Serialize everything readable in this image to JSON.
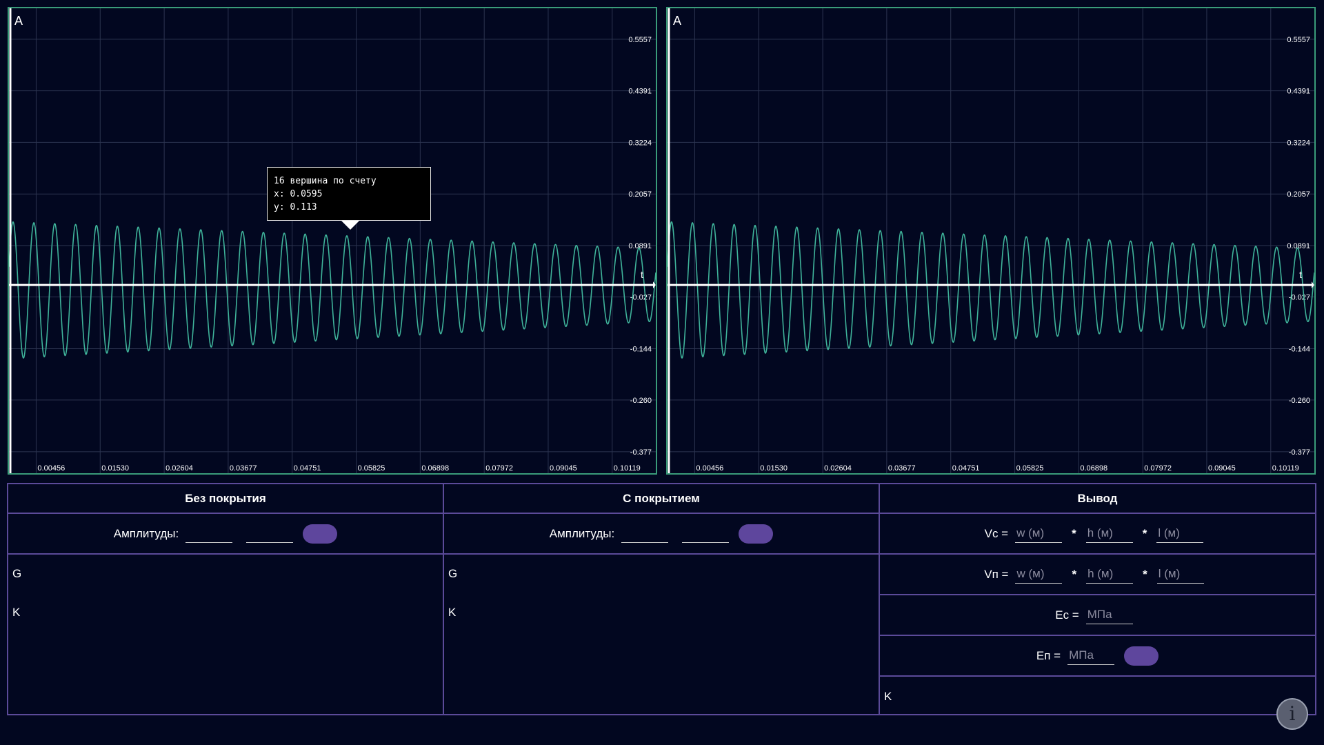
{
  "charts": [
    {
      "id": "left",
      "axis_label_y": "A",
      "axis_label_x": "t",
      "y_ticks": [
        "0.5557",
        "0.4391",
        "0.3224",
        "0.2057",
        "0.0891",
        "-0.027",
        "-0.144",
        "-0.260",
        "-0.377"
      ],
      "x_ticks": [
        "0.00456",
        "0.01530",
        "0.02604",
        "0.03677",
        "0.04751",
        "0.05825",
        "0.06898",
        "0.07972",
        "0.09045",
        "0.10119"
      ],
      "tooltip": {
        "line1": "16 вершина по счету",
        "line2": "x: 0.0595",
        "line3": "y: 0.113"
      }
    },
    {
      "id": "right",
      "axis_label_y": "A",
      "axis_label_x": "t",
      "y_ticks": [
        "0.5557",
        "0.4391",
        "0.3224",
        "0.2057",
        "0.0891",
        "-0.027",
        "-0.144",
        "-0.260",
        "-0.377"
      ],
      "x_ticks": [
        "0.00456",
        "0.01530",
        "0.02604",
        "0.03677",
        "0.04751",
        "0.05825",
        "0.06898",
        "0.07972",
        "0.09045",
        "0.10119"
      ]
    }
  ],
  "chart_data": [
    {
      "type": "line",
      "series": [
        {
          "envelope_start": 0.155,
          "envelope_end": 0.082,
          "cycles": 31
        }
      ],
      "xlim": [
        0.0,
        0.1085
      ],
      "ylim": [
        -0.41,
        0.61
      ],
      "grid": true,
      "line_color": "#3fb39a"
    },
    {
      "type": "line",
      "series": [
        {
          "envelope_start": 0.155,
          "envelope_end": 0.082,
          "cycles": 31
        }
      ],
      "xlim": [
        0.0,
        0.1085
      ],
      "ylim": [
        -0.41,
        0.61
      ],
      "grid": true,
      "line_color": "#3fb39a"
    }
  ],
  "panel": {
    "col1": {
      "title": "Без покрытия",
      "amp_label": "Амплитуды:",
      "g_label": "G",
      "k_label": "K"
    },
    "col2": {
      "title": "С покрытием",
      "amp_label": "Амплитуды:",
      "g_label": "G",
      "k_label": "K"
    },
    "col3": {
      "title": "Вывод",
      "vc_label": "Vc =",
      "vp_label": "Vп =",
      "ec_label": "Ec =",
      "ep_label": "Eп =",
      "k_label": "K",
      "mult": "*",
      "w_placeholder": "w (м)",
      "h_placeholder": "h (м)",
      "l_placeholder": "l (м)",
      "mpa_placeholder": "МПа"
    }
  },
  "info_button": "i",
  "colors": {
    "background": "#020720",
    "chart_border": "#3a9c7a",
    "panel_border": "#5b4a99",
    "button": "#5e469d",
    "signal": "#3fb39a"
  }
}
